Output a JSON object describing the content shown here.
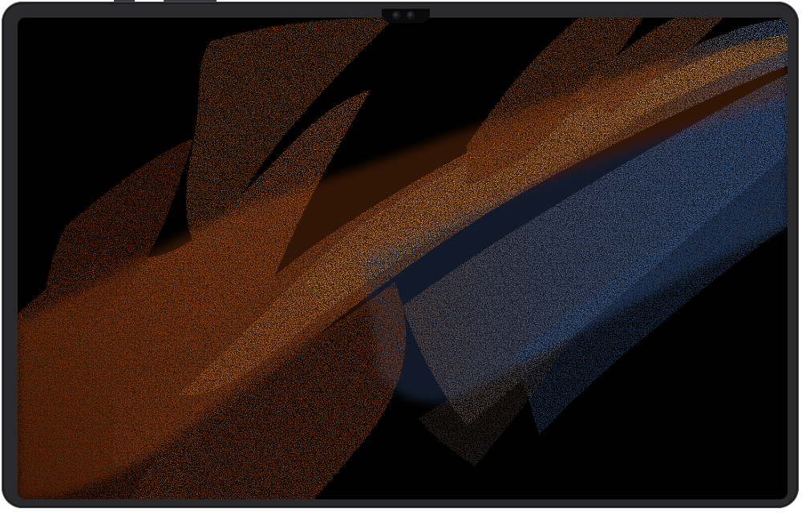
{
  "device": {
    "type": "tablet",
    "orientation": "landscape",
    "frame_color": "#2a2a2c",
    "screen": {
      "state": "wallpaper-only",
      "wallpaper": "particle-sand-waves",
      "colors": {
        "background": "#000000",
        "orange_dark": "#7a2f0c",
        "orange": "#d76a22",
        "orange_bright": "#ffb054",
        "blue": "#6f9fe0"
      }
    },
    "cameras": 2
  }
}
